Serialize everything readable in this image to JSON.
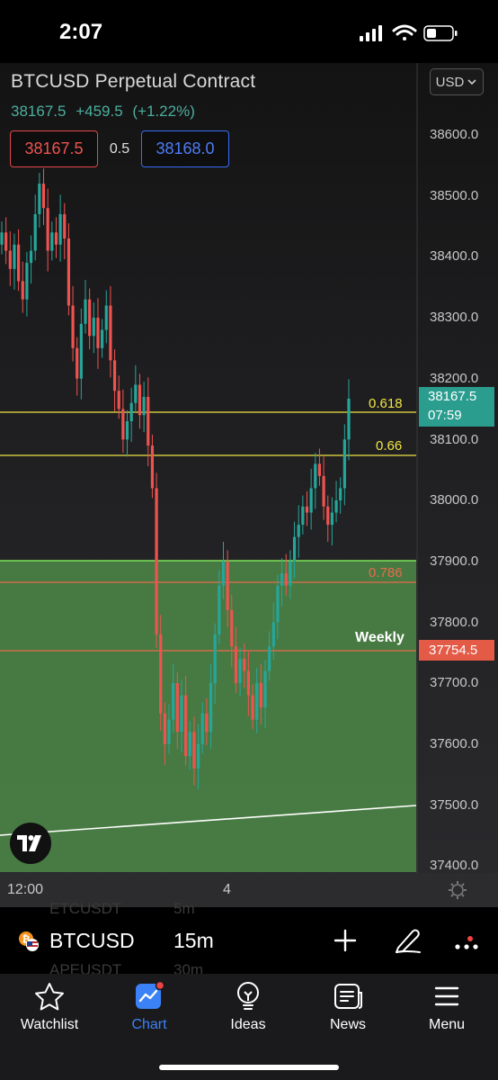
{
  "status_bar": {
    "time": "2:07"
  },
  "header": {
    "title": "BTCUSD Perpetual Contract",
    "last_price": "38167.5",
    "change": "+459.5",
    "change_pct": "(+1.22%)",
    "bid": "38167.5",
    "spread": "0.5",
    "ask": "38168.0",
    "currency": "USD"
  },
  "y_axis_ticks": [
    "38600.0",
    "38500.0",
    "38400.0",
    "38300.0",
    "38200.0",
    "38100.0",
    "38000.0",
    "37900.0",
    "37800.0",
    "37700.0",
    "37600.0",
    "37500.0",
    "37400.0"
  ],
  "fib_levels": [
    {
      "label": "0.618",
      "color": "#f0e442"
    },
    {
      "label": "0.66",
      "color": "#f0e442"
    },
    {
      "label": "0.786",
      "color": "#e86b4e"
    }
  ],
  "weekly_label": "Weekly",
  "price_tags": {
    "current_price": "38167.5",
    "countdown": "07:59",
    "weekly_price": "37754.5"
  },
  "x_axis_ticks": [
    "12:00",
    "4"
  ],
  "symbol_bar": {
    "symbol": "BTCUSD",
    "interval": "15m",
    "ghost_above_symbol": "ETCUSDT",
    "ghost_above_interval": "5m",
    "ghost_below_symbol": "APEUSDT",
    "ghost_below_interval": "30m"
  },
  "tabs": [
    {
      "label": "Watchlist",
      "icon": "star-icon"
    },
    {
      "label": "Chart",
      "icon": "chart-icon",
      "active": true
    },
    {
      "label": "Ideas",
      "icon": "lightbulb-icon"
    },
    {
      "label": "News",
      "icon": "newspaper-icon"
    },
    {
      "label": "Menu",
      "icon": "hamburger-icon"
    }
  ],
  "colors": {
    "up": "#26a69a",
    "down": "#ef5350",
    "zone_fill": "#4e8a48",
    "zone_border": "#7ee35b",
    "accent": "#3b82f6"
  }
}
